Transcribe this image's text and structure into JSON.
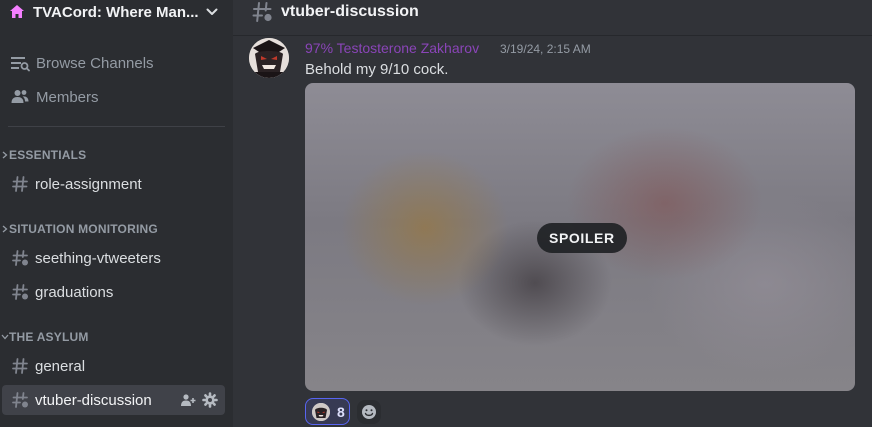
{
  "server": {
    "name": "TVACord: Where Man...",
    "icon": "server-home-icon",
    "accent": "#f47fff"
  },
  "nav": {
    "browse_channels": "Browse Channels",
    "members": "Members"
  },
  "categories": {
    "essentials": "ESSENTIALS",
    "situation_monitoring": "SITUATION MONITORING",
    "the_asylum": "THE ASYLUM"
  },
  "channels": {
    "role_assignment": "role-assignment",
    "seething_vtweeters": "seething-vtweeters",
    "graduations": "graduations",
    "general": "general",
    "vtuber_discussion": "vtuber-discussion"
  },
  "header": {
    "channel_name": "vtuber-discussion"
  },
  "message": {
    "author": "97% Testosterone Zakharov",
    "author_color": "#8a45b8",
    "timestamp": "3/19/24, 2:15 AM",
    "text": "Behold my 9/10 cock.",
    "attachment": {
      "spoiler_label": "SPOILER"
    },
    "reactions": [
      {
        "emoji": "custom-avatar-emoji",
        "count": "8"
      }
    ]
  },
  "colors": {
    "sidebar_bg": "#2b2d31",
    "main_bg": "#313338",
    "active_channel_bg": "#404249",
    "reaction_border": "#5865f2"
  }
}
